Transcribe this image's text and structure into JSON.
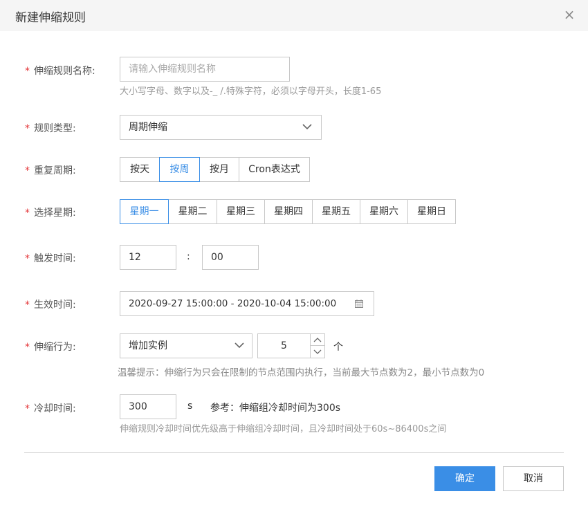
{
  "dialog": {
    "title": "新建伸缩规则",
    "close_icon": "×"
  },
  "form": {
    "required_mark": "*",
    "name": {
      "label": "伸缩规则名称:",
      "placeholder": "请输入伸缩规则名称",
      "hint": "大小写字母、数字以及-_ /.特殊字符，必须以字母开头，长度1-65"
    },
    "type": {
      "label": "规则类型:",
      "value": "周期伸缩"
    },
    "period": {
      "label": "重复周期:",
      "options": [
        "按天",
        "按周",
        "按月",
        "Cron表达式"
      ],
      "selected_index": 1
    },
    "weekday": {
      "label": "选择星期:",
      "options": [
        "星期一",
        "星期二",
        "星期三",
        "星期四",
        "星期五",
        "星期六",
        "星期日"
      ],
      "selected_index": 0
    },
    "trigger_time": {
      "label": "触发时间:",
      "hour": "12",
      "separator": ":",
      "minute": "00"
    },
    "effective_time": {
      "label": "生效时间:",
      "value": "2020-09-27 15:00:00 - 2020-10-04 15:00:00"
    },
    "action": {
      "label": "伸缩行为:",
      "value": "增加实例",
      "count": "5",
      "unit": "个",
      "hint": "温馨提示：伸缩行为只会在限制的节点范围内执行，当前最大节点数为2，最小节点数为0"
    },
    "cooldown": {
      "label": "冷却时间:",
      "value": "300",
      "unit": "s",
      "reference": "参考：伸缩组冷却时间为300s",
      "hint": "伸缩规则冷却时间优先级高于伸缩组冷却时间，且冷却时间处于60s~86400s之间"
    }
  },
  "footer": {
    "confirm": "确定",
    "cancel": "取消"
  },
  "colors": {
    "accent": "#3a8ee6",
    "required": "#e4393c"
  }
}
